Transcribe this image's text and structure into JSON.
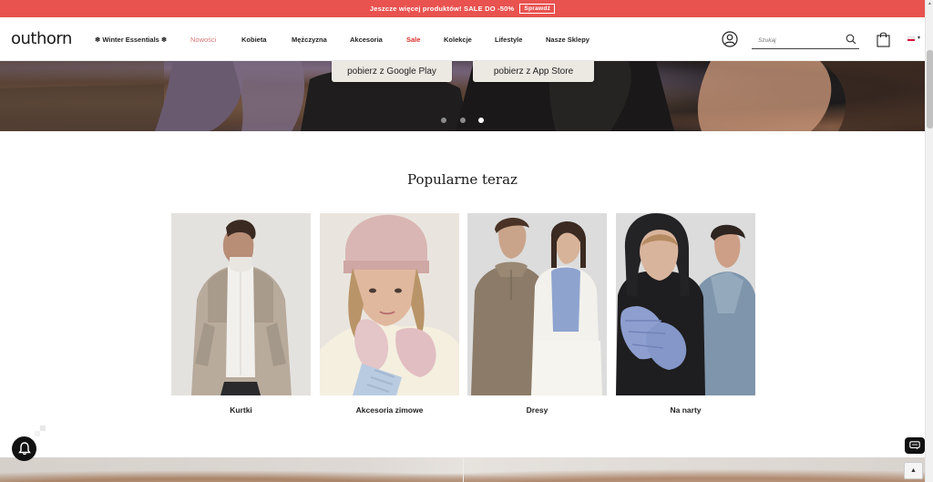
{
  "promo": {
    "text": "Jeszcze więcej produktów! SALE DO -50%",
    "button": "Sprawdź"
  },
  "header": {
    "logo": "outhorn",
    "nav": [
      {
        "label": "❄ Winter Essentials ❄"
      },
      {
        "label": "Nowości"
      },
      {
        "label": "Kobieta"
      },
      {
        "label": "Mężczyzna"
      },
      {
        "label": "Akcesoria"
      },
      {
        "label": "Sale"
      },
      {
        "label": "Kolekcje"
      },
      {
        "label": "Lifestyle"
      },
      {
        "label": "Nasze Sklepy"
      }
    ],
    "search_placeholder": "Szukaj",
    "language": "PL"
  },
  "hero": {
    "google_play": "pobierz z Google Play",
    "app_store": "pobierz z App Store",
    "slide_count": 3,
    "active_slide": 3
  },
  "popular": {
    "title": "Popularne teraz",
    "cards": [
      {
        "label": "Kurtki"
      },
      {
        "label": "Akcesoria zimowe"
      },
      {
        "label": "Dresy"
      },
      {
        "label": "Na narty"
      }
    ]
  },
  "colors": {
    "promo_bg": "#e8524f",
    "sale_text": "#d9302b",
    "nowosci_text": "#d87878"
  },
  "icons": [
    "user-icon",
    "search-icon",
    "shopping-bag-icon",
    "flag-pl-icon",
    "bell-icon",
    "chat-icon",
    "arrow-up-icon"
  ]
}
